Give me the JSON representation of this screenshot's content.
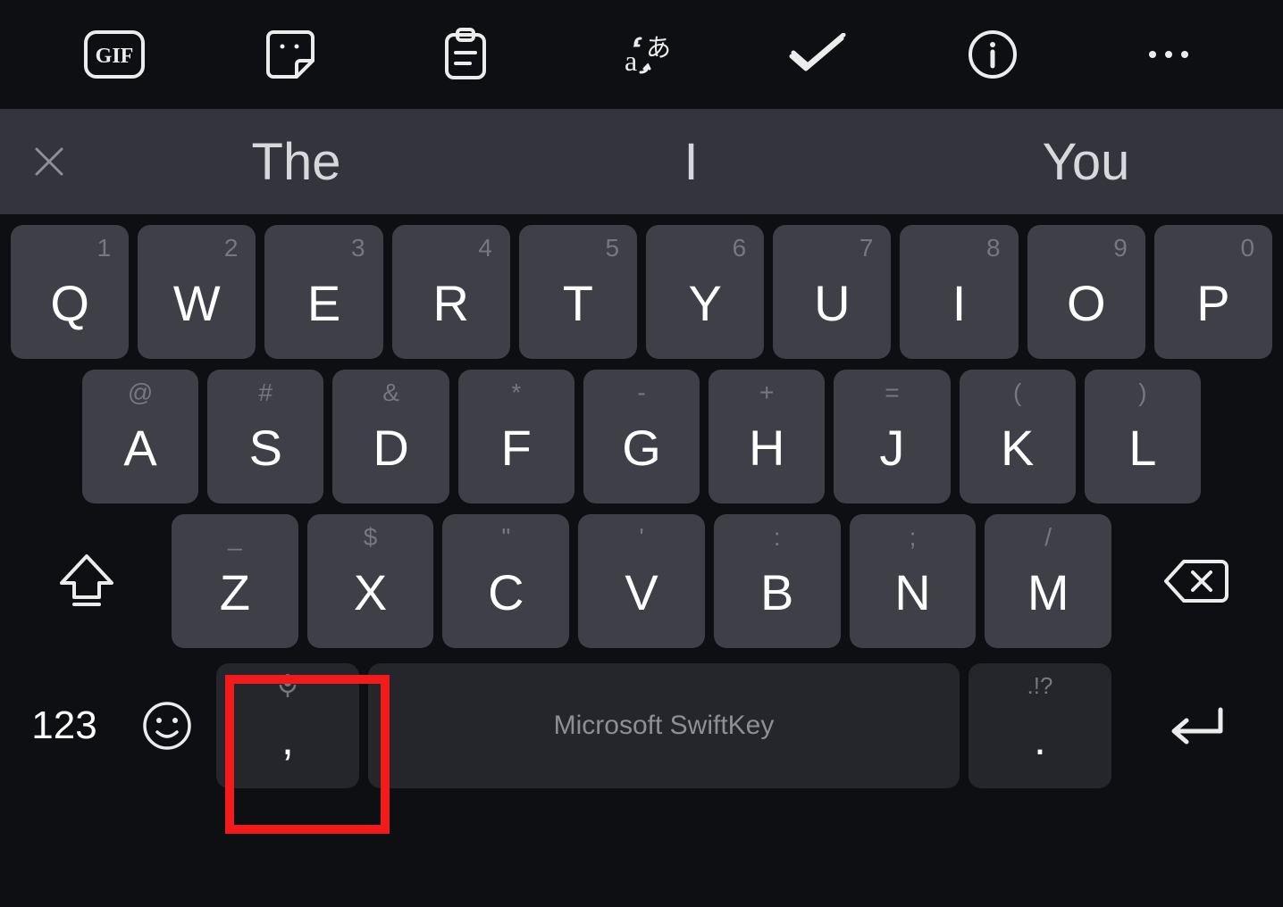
{
  "toolbar": {
    "items": [
      {
        "name": "gif-icon"
      },
      {
        "name": "sticker-icon"
      },
      {
        "name": "clipboard-icon"
      },
      {
        "name": "translate-icon"
      },
      {
        "name": "autocorrect-icon"
      },
      {
        "name": "info-icon"
      },
      {
        "name": "more-icon"
      }
    ]
  },
  "suggestions": {
    "close_label": "×",
    "items": [
      "The",
      "I",
      "You"
    ]
  },
  "keys": {
    "row1": [
      {
        "main": "Q",
        "sec": "1"
      },
      {
        "main": "W",
        "sec": "2"
      },
      {
        "main": "E",
        "sec": "3"
      },
      {
        "main": "R",
        "sec": "4"
      },
      {
        "main": "T",
        "sec": "5"
      },
      {
        "main": "Y",
        "sec": "6"
      },
      {
        "main": "U",
        "sec": "7"
      },
      {
        "main": "I",
        "sec": "8"
      },
      {
        "main": "O",
        "sec": "9"
      },
      {
        "main": "P",
        "sec": "0"
      }
    ],
    "row2": [
      {
        "main": "A",
        "sec": "@"
      },
      {
        "main": "S",
        "sec": "#"
      },
      {
        "main": "D",
        "sec": "&"
      },
      {
        "main": "F",
        "sec": "*"
      },
      {
        "main": "G",
        "sec": "-"
      },
      {
        "main": "H",
        "sec": "+"
      },
      {
        "main": "J",
        "sec": "="
      },
      {
        "main": "K",
        "sec": "("
      },
      {
        "main": "L",
        "sec": ")"
      }
    ],
    "row3": [
      {
        "main": "Z",
        "sec": "_"
      },
      {
        "main": "X",
        "sec": "$"
      },
      {
        "main": "C",
        "sec": "\""
      },
      {
        "main": "V",
        "sec": "'"
      },
      {
        "main": "B",
        "sec": ":"
      },
      {
        "main": "N",
        "sec": ";"
      },
      {
        "main": "M",
        "sec": "/"
      }
    ]
  },
  "bottom": {
    "numbers_label": "123",
    "comma": {
      "main": ",",
      "sec_name": "mic-icon"
    },
    "space_label": "Microsoft SwiftKey",
    "period": {
      "main": ".",
      "sec": ".!?"
    }
  },
  "colors": {
    "background": "#0e0f13",
    "key_bg": "#3e3f47",
    "dark_key_bg": "#25262c",
    "sugbar_bg": "#33343c",
    "highlight": "#f21b1b"
  }
}
